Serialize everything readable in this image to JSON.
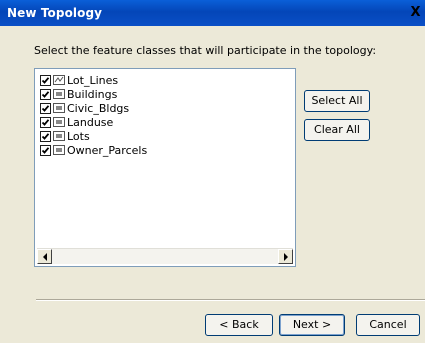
{
  "window": {
    "title": "New Topology",
    "close_glyph": "X"
  },
  "instruction": "Select the feature classes that will participate in the topology:",
  "feature_classes": [
    {
      "label": "Lot_Lines",
      "checked": true,
      "icon": "line-feature-class-icon"
    },
    {
      "label": "Buildings",
      "checked": true,
      "icon": "polygon-feature-class-icon"
    },
    {
      "label": "Civic_Bldgs",
      "checked": true,
      "icon": "polygon-feature-class-icon"
    },
    {
      "label": "Landuse",
      "checked": true,
      "icon": "polygon-feature-class-icon"
    },
    {
      "label": "Lots",
      "checked": true,
      "icon": "polygon-feature-class-icon"
    },
    {
      "label": "Owner_Parcels",
      "checked": true,
      "icon": "polygon-feature-class-icon"
    }
  ],
  "buttons": {
    "select_all": "Select All",
    "clear_all": "Clear All",
    "back": "< Back",
    "next": "Next >",
    "cancel": "Cancel"
  }
}
